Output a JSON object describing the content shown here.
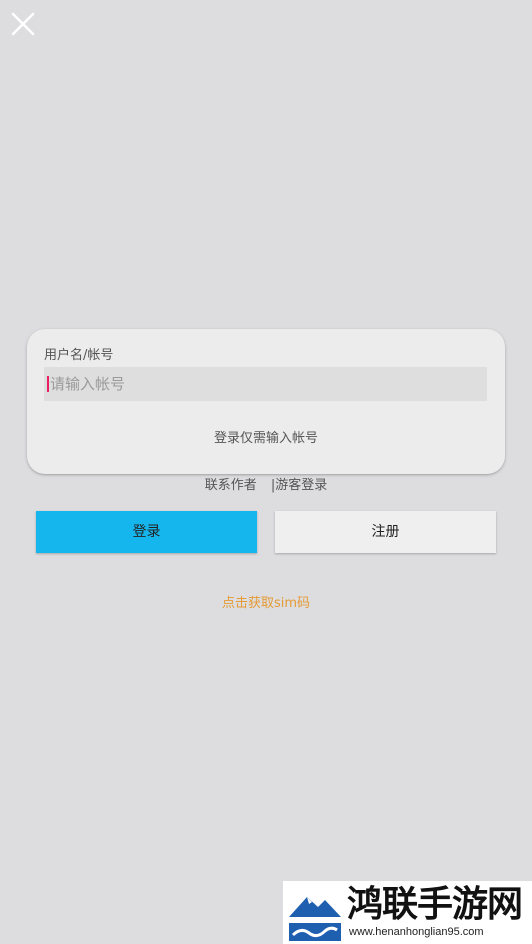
{
  "header": {
    "close_icon": "close-icon"
  },
  "login_form": {
    "username_label": "用户名/帐号",
    "account_placeholder": "请输入帐号",
    "account_value": "",
    "hint": "登录仅需输入帐号"
  },
  "links": {
    "contact_author": "联系作者",
    "separator": "|",
    "guest_login": "游客登录"
  },
  "buttons": {
    "login": "登录",
    "register": "注册"
  },
  "sim_link": "点击获取sim码",
  "watermark": {
    "title": "鸿联手游网",
    "url": "www.henanhonglian95.com"
  },
  "colors": {
    "background": "#dddde0",
    "primary": "#15b6ee",
    "link_accent": "#e59a33",
    "caret": "#e91e63"
  }
}
